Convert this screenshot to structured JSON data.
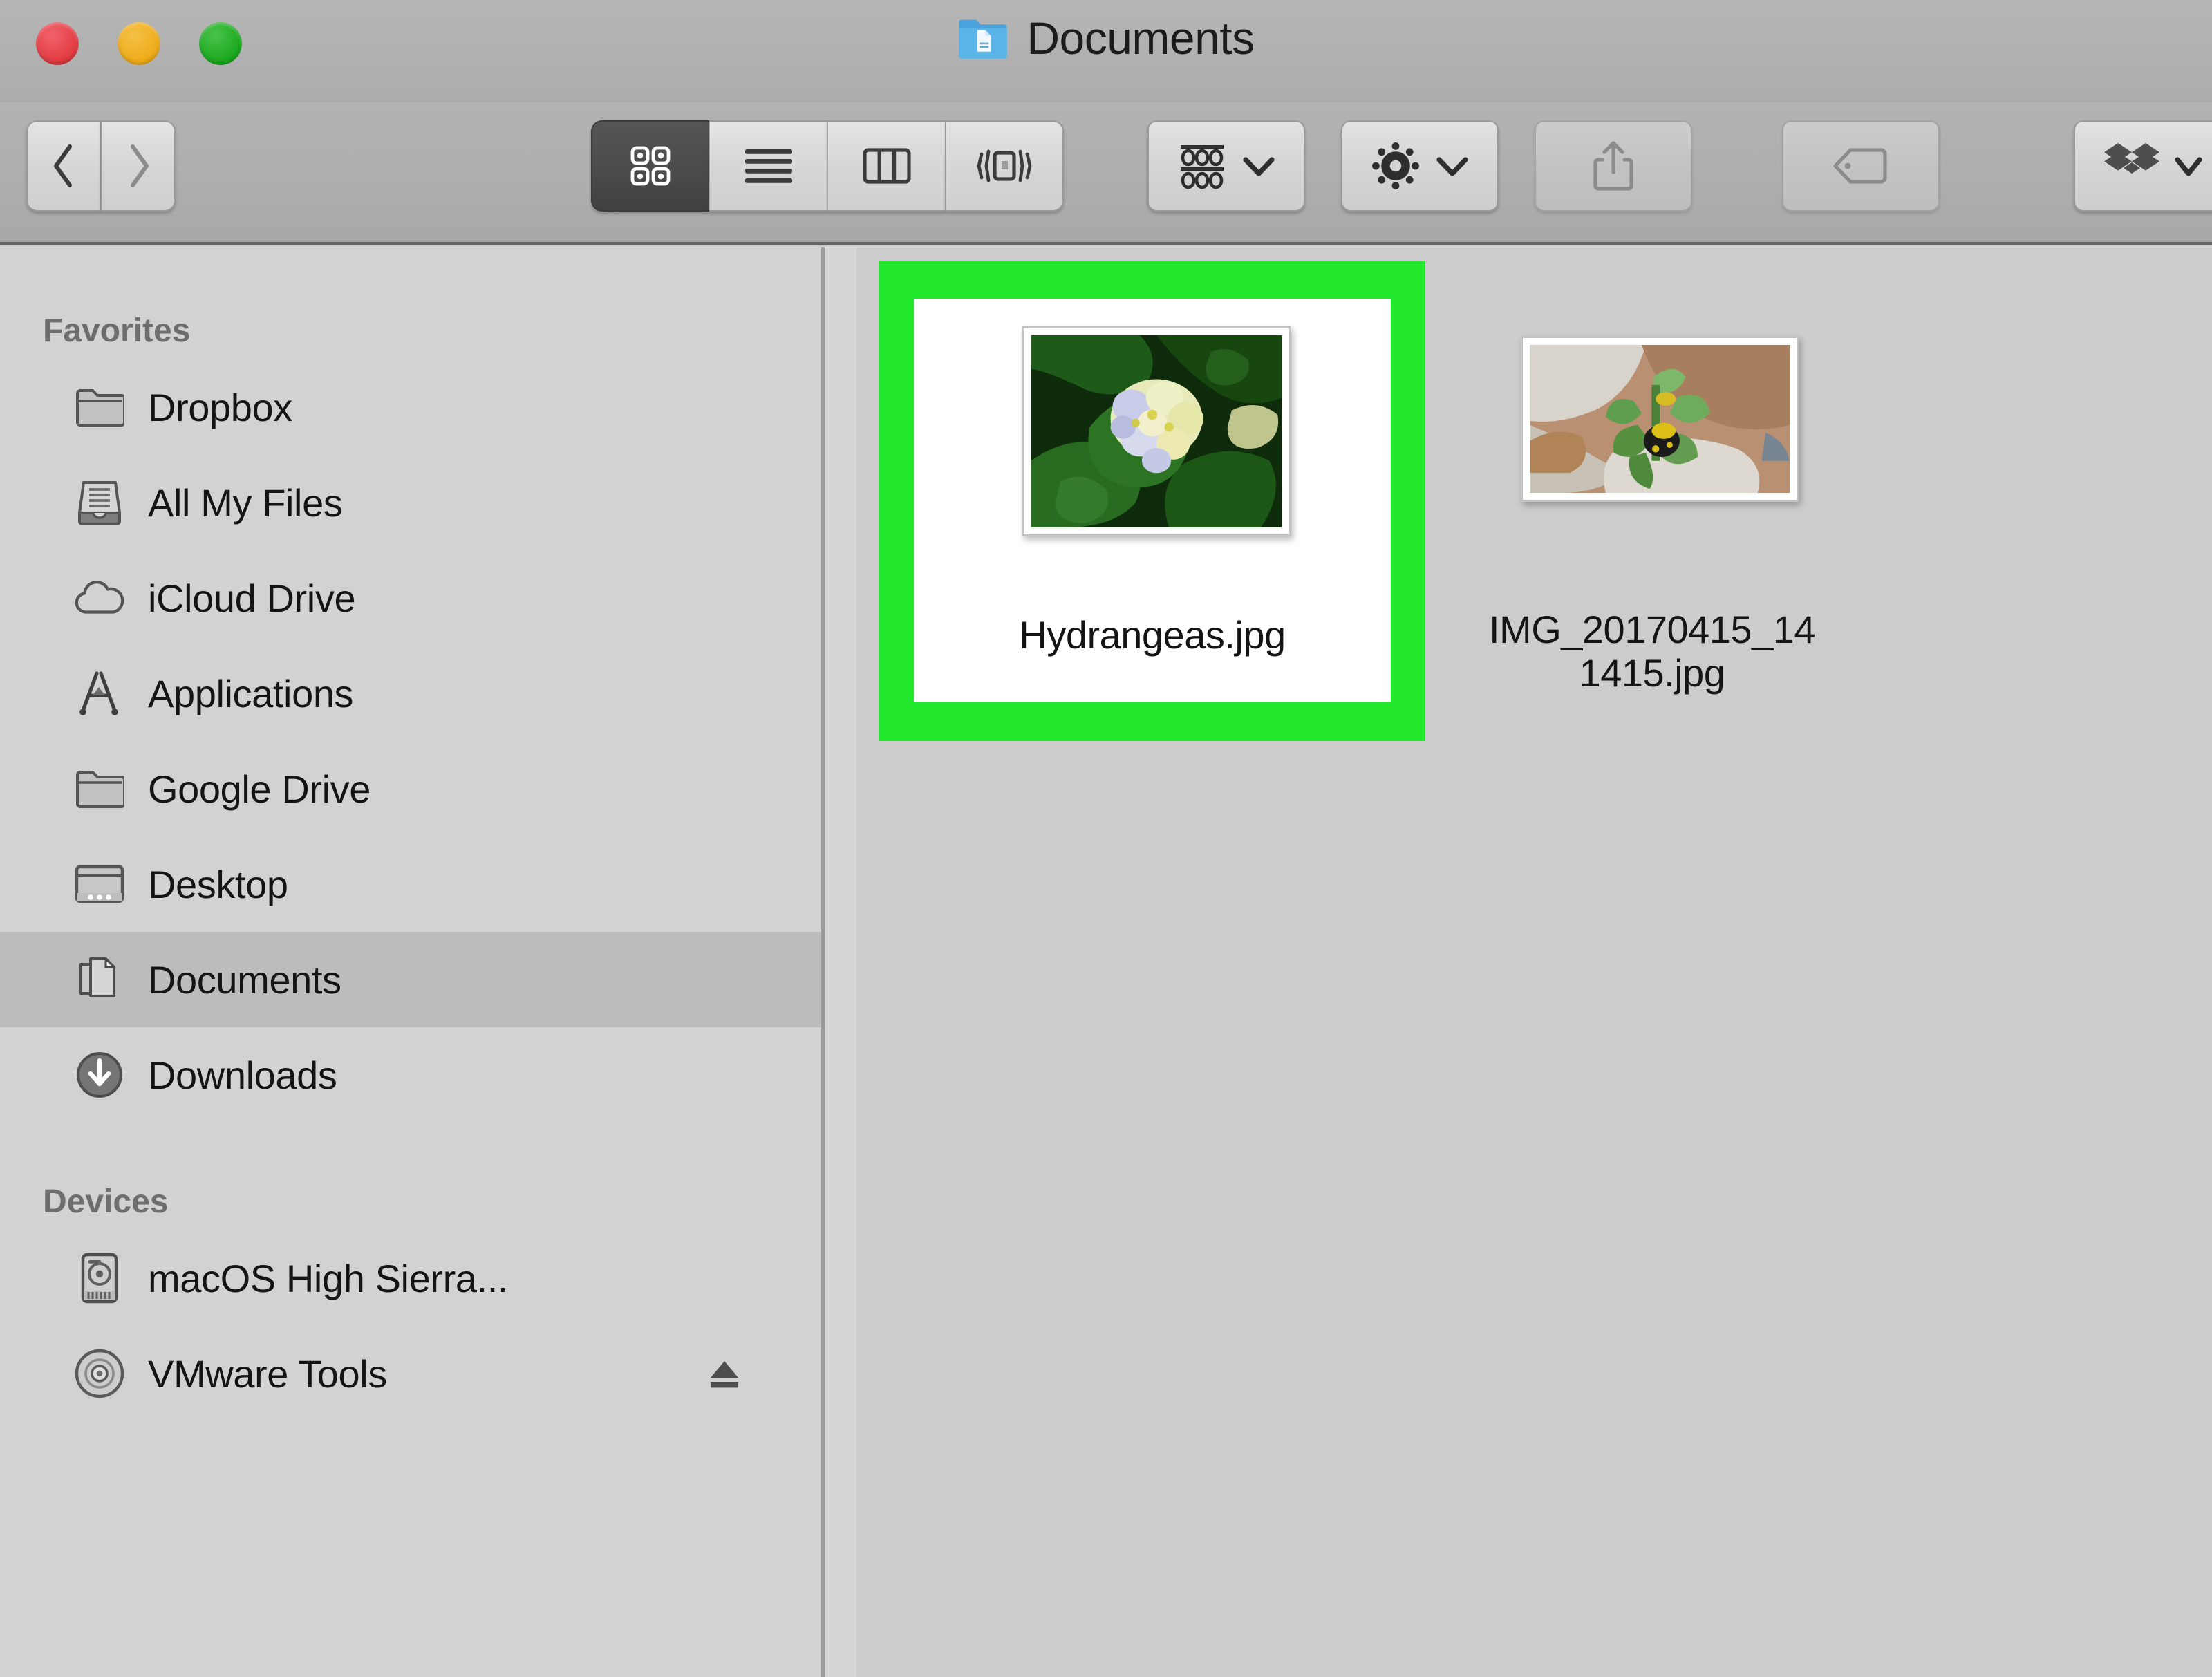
{
  "window": {
    "title": "Documents",
    "title_icon": "blue-documents-folder-icon",
    "traffic_lights": [
      {
        "name": "close",
        "color": "#e03a3f"
      },
      {
        "name": "minimize",
        "color": "#eeab18"
      },
      {
        "name": "zoom",
        "color": "#19a81c"
      }
    ]
  },
  "toolbar": {
    "back_icon": "chevron-left-icon",
    "forward_icon": "chevron-right-icon",
    "view_modes": [
      {
        "id": "icon",
        "icon": "grid-view-icon",
        "label": "Icon View",
        "selected": true
      },
      {
        "id": "list",
        "icon": "list-view-icon",
        "label": "List View",
        "selected": false
      },
      {
        "id": "column",
        "icon": "column-view-icon",
        "label": "Column View",
        "selected": false
      },
      {
        "id": "cover",
        "icon": "coverflow-view-icon",
        "label": "Cover Flow",
        "selected": false
      }
    ],
    "arrange": {
      "icon": "arrange-grid-icon",
      "label": "Arrange",
      "chevron": "chevron-down-icon"
    },
    "action": {
      "icon": "gear-icon",
      "label": "Action",
      "chevron": "chevron-down-icon"
    },
    "share": {
      "icon": "share-upload-icon",
      "label": "Share",
      "disabled": true
    },
    "tag": {
      "icon": "tag-icon",
      "label": "Tags",
      "disabled": true
    },
    "dropbox": {
      "icon": "dropbox-icon",
      "label": "Dropbox",
      "chevron": "chevron-down-icon"
    }
  },
  "sidebar": {
    "sections": [
      {
        "header": "Favorites",
        "items": [
          {
            "label": "Dropbox",
            "icon": "folder-icon",
            "selected": false
          },
          {
            "label": "All My Files",
            "icon": "all-my-files-icon",
            "selected": false
          },
          {
            "label": "iCloud Drive",
            "icon": "cloud-icon",
            "selected": false
          },
          {
            "label": "Applications",
            "icon": "applications-icon",
            "selected": false
          },
          {
            "label": "Google Drive",
            "icon": "folder-icon",
            "selected": false
          },
          {
            "label": "Desktop",
            "icon": "desktop-icon",
            "selected": false
          },
          {
            "label": "Documents",
            "icon": "documents-icon",
            "selected": true
          },
          {
            "label": "Downloads",
            "icon": "downloads-icon",
            "selected": false
          }
        ]
      },
      {
        "header": "Devices",
        "items": [
          {
            "label": "macOS High Sierra...",
            "icon": "hard-drive-icon",
            "selected": false,
            "eject": false
          },
          {
            "label": "VMware Tools",
            "icon": "optical-disc-icon",
            "selected": false,
            "eject": true,
            "eject_icon": "eject-icon"
          }
        ]
      }
    ]
  },
  "content": {
    "files": [
      {
        "name": "Hydrangeas.jpg",
        "thumbnail": "hydrangea-flower-photo",
        "selected": true,
        "highlighted": true
      },
      {
        "name": "IMG_20170415_141415.jpg",
        "name_line1": "IMG_20170415_14",
        "name_line2": "1415.jpg",
        "thumbnail": "green-plant-photo",
        "selected": false,
        "highlighted": false
      }
    ]
  },
  "annotation": {
    "type": "highlight-rectangle",
    "color": "#22e82e",
    "target": "Hydrangeas.jpg"
  },
  "colors": {
    "titlebar": "#b0b0b0",
    "toolbar": "#aeaeae",
    "sidebar": "#d2d2d2",
    "content": "#cccccc",
    "sidebar_selected": "#bcbcbc",
    "highlight_green": "#22e82e",
    "text": "#141414",
    "header_text": "#6e6e6e"
  }
}
